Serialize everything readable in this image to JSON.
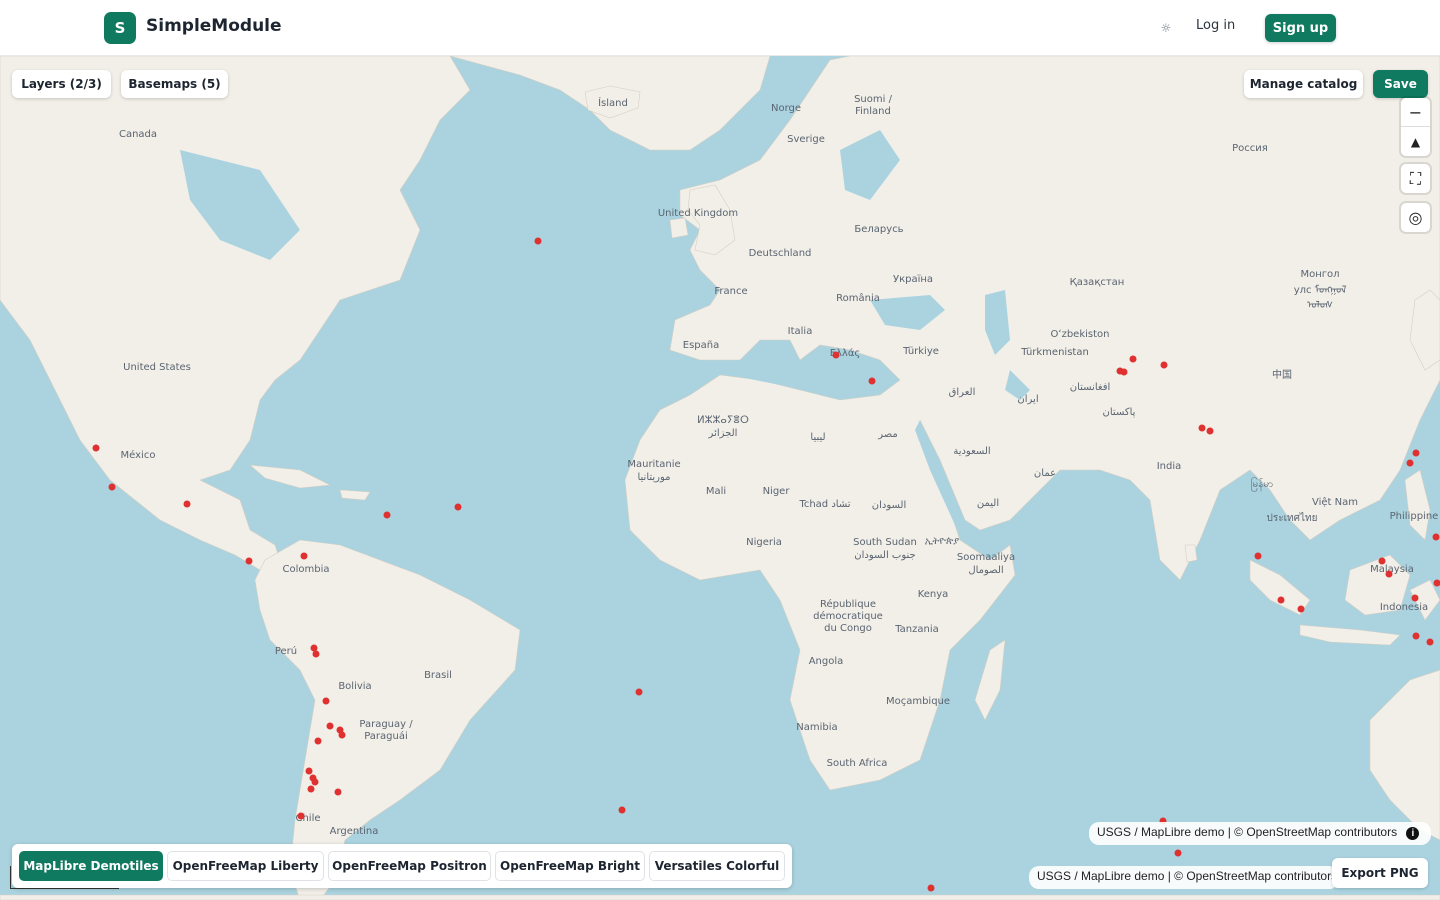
{
  "header": {
    "logo_letter": "S",
    "brand": "SimpleModule",
    "theme_icon": "sun-icon",
    "login_label": "Log in",
    "signup_label": "Sign up"
  },
  "toolbar": {
    "layers_label": "Layers (2/3)",
    "basemaps_label": "Basemaps (5)",
    "manage_catalog_label": "Manage catalog",
    "save_label": "Save",
    "export_label": "Export PNG"
  },
  "controls": {
    "zoom_out": "−",
    "compass": "▲",
    "fullscreen": "⛶",
    "locate": "◎"
  },
  "attribution": {
    "text1": "USGS / MapLibre demo | © OpenStreetMap contributors",
    "text2": "USGS / MapLibre demo | © OpenStreetMap contributors",
    "info_icon": "i"
  },
  "basemaps": [
    {
      "label": "MapLibre Demotiles",
      "active": true
    },
    {
      "label": "OpenFreeMap Liberty",
      "active": false
    },
    {
      "label": "OpenFreeMap Positron",
      "active": false
    },
    {
      "label": "OpenFreeMap Bright",
      "active": false
    },
    {
      "label": "Versatiles Colorful",
      "active": false
    }
  ],
  "map_labels": [
    "Ísland",
    "Norge",
    "Suomi /",
    "Finland",
    "Sverige",
    "Россия",
    "Canada",
    "United Kingdom",
    "Беларусь",
    "Deutschland",
    "Україна",
    "Қазақстан",
    "Монгол",
    "улс ᠮᠣᠩᠭᠣᠯ",
    "ᠤᠯᠤᠰ",
    "France",
    "România",
    "Italia",
    "Oʻzbekiston",
    "Türkmenistan",
    "España",
    "Ελλάς",
    "Türkiye",
    "中国",
    "United States",
    "العراق",
    "ایران",
    "افغانستان",
    "پاکستان",
    "ⵍⵣⵣⴰⵢⴻⵔ",
    "الجزائر",
    "ليبيا",
    "مصر",
    "México",
    "السعودية",
    "India",
    "Mauritanie",
    "موريتانيا",
    "عمان",
    "မြန်မာ",
    "Việt Nam",
    "Mali",
    "Niger",
    "Tchad تشاد",
    "السودان",
    "اليمن",
    "ประเทศไทย",
    "Philippine",
    "South Sudan",
    "جنوب السودان",
    "ኢትዮጵያ",
    "Nigeria",
    "Soomaaliya",
    "الصومال",
    "Colombia",
    "Malaysia",
    "Kenya",
    "République",
    "démocratique",
    "du Congo",
    "Indonesia",
    "Tanzania",
    "Perú",
    "Angola",
    "Brasil",
    "Bolivia",
    "Moçambique",
    "Paraguay /",
    "Paraguái",
    "Namibia",
    "South Africa",
    "Chile",
    "Argentina"
  ],
  "marker_color": "#e03131",
  "land_color": "#f2efe9",
  "water_color": "#aad3df"
}
